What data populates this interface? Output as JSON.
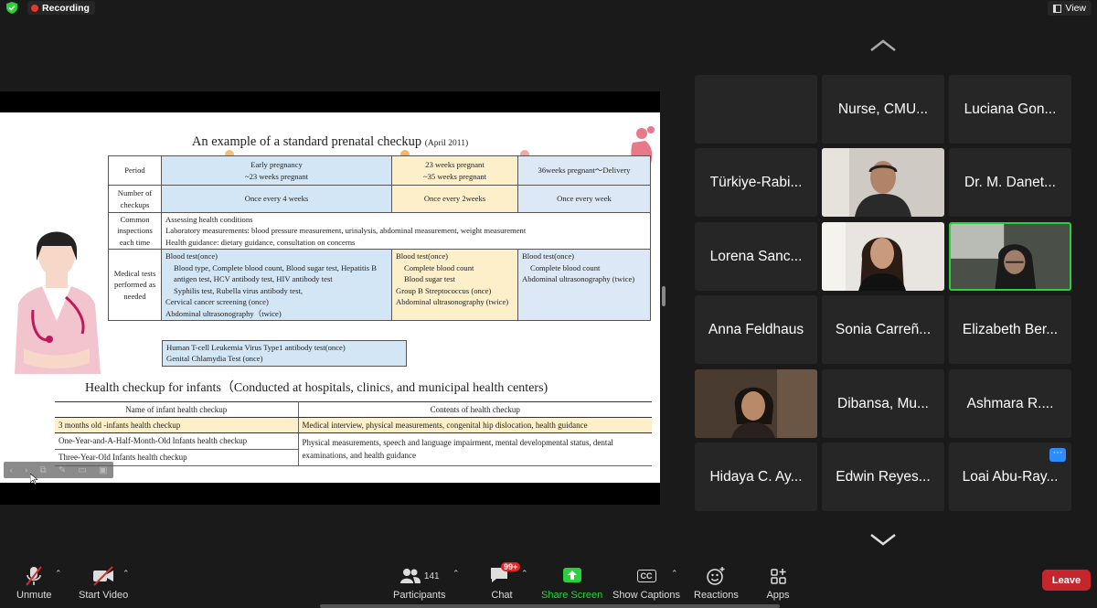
{
  "top": {
    "recording": "Recording",
    "view": "View"
  },
  "slide": {
    "title": "An example of a standard prenatal checkup",
    "title_date": "(April 2011)",
    "rows": {
      "period_label": "Period",
      "period_1": "Early pregnancy",
      "period_1b": "~23 weeks pregnant",
      "period_2": "23 weeks pregnant",
      "period_2b": "~35 weeks pregnant",
      "period_3": "36weeks pregnant～Delivery",
      "num_label": "Number of checkups",
      "num_1": "Once every 4 weeks",
      "num_2": "Once every 2weeks",
      "num_3": "Once every week",
      "common_label": "Common inspections each time",
      "common_1": "Assessing health conditions",
      "common_2": "Laboratory measurements: blood pressure measurement, urinalysis, abdominal measurement, weight measurement",
      "common_3": "Health guidance: dietary guidance, consultation on concerns",
      "medical_label": "Medical tests performed as needed",
      "med1_a": "Blood test(once)",
      "med1_b": "Blood type, Complete blood count, Blood sugar test, Hepatitis B antigen test, HCV antibody test, HIV antibody test",
      "med1_c": "Syphilis test, Rubella virus antibody test,",
      "med1_d": "Cervical cancer screening (once)",
      "med1_e": "Abdominal ultrasonography（twice)",
      "med2_a": "Blood test(once)",
      "med2_b": "Complete blood count",
      "med2_c": "Blood sugar test",
      "med2_d": "Group B Streptococcus (once)",
      "med2_e": "Abdominal ultrasonography (twice)",
      "med3_a": "Blood test(once)",
      "med3_b": "Complete blood count",
      "med3_c": "Abdominal ultrasonography (twice)",
      "extra_a": "Human T-cell Leukemia Virus Type1 antibody test(once)",
      "extra_b": "Genital Chlamydia Test (once)"
    },
    "infant_title": "Health checkup for infants（Conducted at hospitals, clinics, and municipal health centers)",
    "infant_table": {
      "head_1": "Name of infant health checkup",
      "head_2": "Contents of health checkup",
      "r1_name": "3 months old -infants health checkup",
      "r1_content": "Medical interview, physical measurements, congenital hip dislocation, health guidance",
      "r2_name": "One-Year-and-A-Half-Month-Old Infants health checkup",
      "r2_content": "Physical measurements, speech and language impairment, mental developmental status, dental examinations, and health guidance",
      "r3_name": "Three-Year-Old Infants health checkup"
    }
  },
  "gallery": {
    "participants": [
      "",
      "Nurse, CMU...",
      "Luciana Gon...",
      "Türkiye-Rabi...",
      "",
      "Dr. M. Danet...",
      "Lorena Sanc...",
      "",
      "",
      "Anna Feldhaus",
      "Sonia Carreñ...",
      "Elizabeth Ber...",
      "",
      "Dibansa, Mu...",
      "Ashmara R....",
      "Hidaya C. Ay...",
      "Edwin Reyes...",
      "Loai Abu-Ray..."
    ],
    "more_label": "···"
  },
  "toolbar": {
    "unmute": "Unmute",
    "start_video": "Start Video",
    "participants": "Participants",
    "participants_count": "141",
    "chat": "Chat",
    "chat_badge": "99+",
    "share_screen": "Share Screen",
    "show_captions": "Show Captions",
    "reactions": "Reactions",
    "apps": "Apps",
    "leave": "Leave",
    "cc": "CC"
  }
}
